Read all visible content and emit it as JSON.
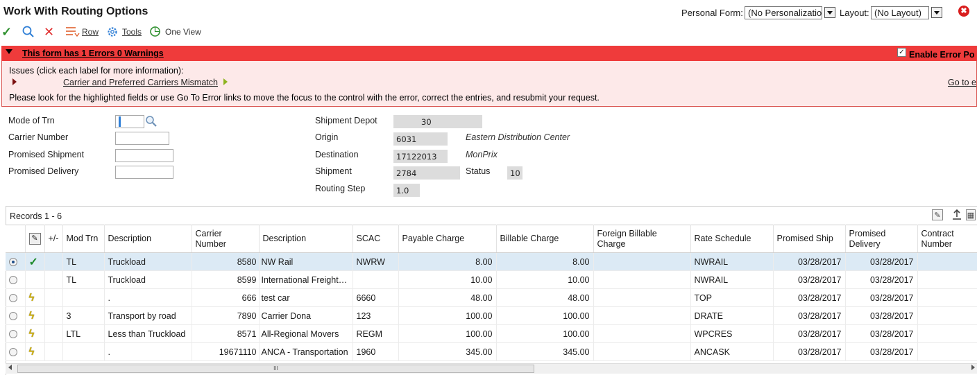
{
  "header": {
    "title": "Work With Routing Options",
    "personal_form_label": "Personal Form:",
    "personal_form_value": "(No Personalization)",
    "layout_label": "Layout:",
    "layout_value": "(No Layout)",
    "close_glyph": "✖"
  },
  "toolbar": {
    "ok_glyph": "✓",
    "find_glyph": "⚲",
    "cancel_glyph": "✕",
    "row_label": "Row",
    "tools_label": "Tools",
    "one_view_label": "One View"
  },
  "errors": {
    "title": "This form has 1 Errors 0 Warnings",
    "enable_label": "Enable Error Po",
    "enable_checked": "✓",
    "issues_text": "Issues (click each label for more information):",
    "issue_link": "Carrier and Preferred Carriers Mismatch",
    "goto_link": "Go to e",
    "instructions": "Please look for the highlighted fields or use Go To Error links to move the focus to the control with the error, correct the entries, and resubmit your request.",
    "colors": {
      "header_bg": "#ef3b3b",
      "body_bg": "#fde9e9"
    }
  },
  "form": {
    "left": [
      {
        "label": "Mode of Trn",
        "value": ""
      },
      {
        "label": "Carrier Number",
        "value": ""
      },
      {
        "label": "Promised Shipment",
        "value": ""
      },
      {
        "label": "Promised Delivery",
        "value": ""
      }
    ],
    "shipment_depot": {
      "label": "Shipment Depot",
      "value": "30"
    },
    "origin": {
      "label": "Origin",
      "value": "6031",
      "desc": "Eastern Distribution Center"
    },
    "destination": {
      "label": "Destination",
      "value": "17122013",
      "desc": "MonPrix"
    },
    "shipment": {
      "label": "Shipment",
      "value": "2784",
      "status_label": "Status",
      "status_value": "10"
    },
    "routing_step": {
      "label": "Routing Step",
      "value": "1.0"
    }
  },
  "grid": {
    "records_label": "Records 1 - 6",
    "columns": [
      "",
      "",
      "+/-",
      "Mod Trn",
      "Description",
      "Carrier Number",
      "Description",
      "SCAC",
      "Payable Charge",
      "Billable Charge",
      "Foreign Billable Charge",
      "Rate Schedule",
      "Promised Ship",
      "Promised Delivery",
      "Contract Number"
    ],
    "rows": [
      {
        "selected": true,
        "status": "check",
        "mod": "TL",
        "desc": "Truckload",
        "carrier": "8580",
        "carrier_desc": "NW Rail",
        "scac": "NWRW",
        "payable": "8.00",
        "billable": "8.00",
        "foreign": "",
        "rate": "NWRAIL",
        "ship": "03/28/2017",
        "delivery": "03/28/2017",
        "contract": ""
      },
      {
        "selected": false,
        "status": "",
        "mod": "TL",
        "desc": "Truckload",
        "carrier": "8599",
        "carrier_desc": "International Freight F...",
        "scac": "",
        "payable": "10.00",
        "billable": "10.00",
        "foreign": "",
        "rate": "NWRAIL",
        "ship": "03/28/2017",
        "delivery": "03/28/2017",
        "contract": ""
      },
      {
        "selected": false,
        "status": "bolt",
        "mod": "",
        "desc": ".",
        "carrier": "666",
        "carrier_desc": "test car",
        "scac": "6660",
        "payable": "48.00",
        "billable": "48.00",
        "foreign": "",
        "rate": "TOP",
        "ship": "03/28/2017",
        "delivery": "03/28/2017",
        "contract": ""
      },
      {
        "selected": false,
        "status": "bolt",
        "mod": "3",
        "desc": "Transport by road",
        "carrier": "7890",
        "carrier_desc": "Carrier Dona",
        "scac": "123",
        "payable": "100.00",
        "billable": "100.00",
        "foreign": "",
        "rate": "DRATE",
        "ship": "03/28/2017",
        "delivery": "03/28/2017",
        "contract": ""
      },
      {
        "selected": false,
        "status": "bolt",
        "mod": "LTL",
        "desc": "Less than Truckload",
        "carrier": "8571",
        "carrier_desc": "All-Regional Movers",
        "scac": "REGM",
        "payable": "100.00",
        "billable": "100.00",
        "foreign": "",
        "rate": "WPCRES",
        "ship": "03/28/2017",
        "delivery": "03/28/2017",
        "contract": ""
      },
      {
        "selected": false,
        "status": "bolt",
        "mod": "",
        "desc": ".",
        "carrier": "19671110",
        "carrier_desc": "ANCA - Transportation",
        "scac": "1960",
        "payable": "345.00",
        "billable": "345.00",
        "foreign": "",
        "rate": "ANCASK",
        "ship": "03/28/2017",
        "delivery": "03/28/2017",
        "contract": ""
      }
    ],
    "scroll_thumb_label": "III"
  }
}
